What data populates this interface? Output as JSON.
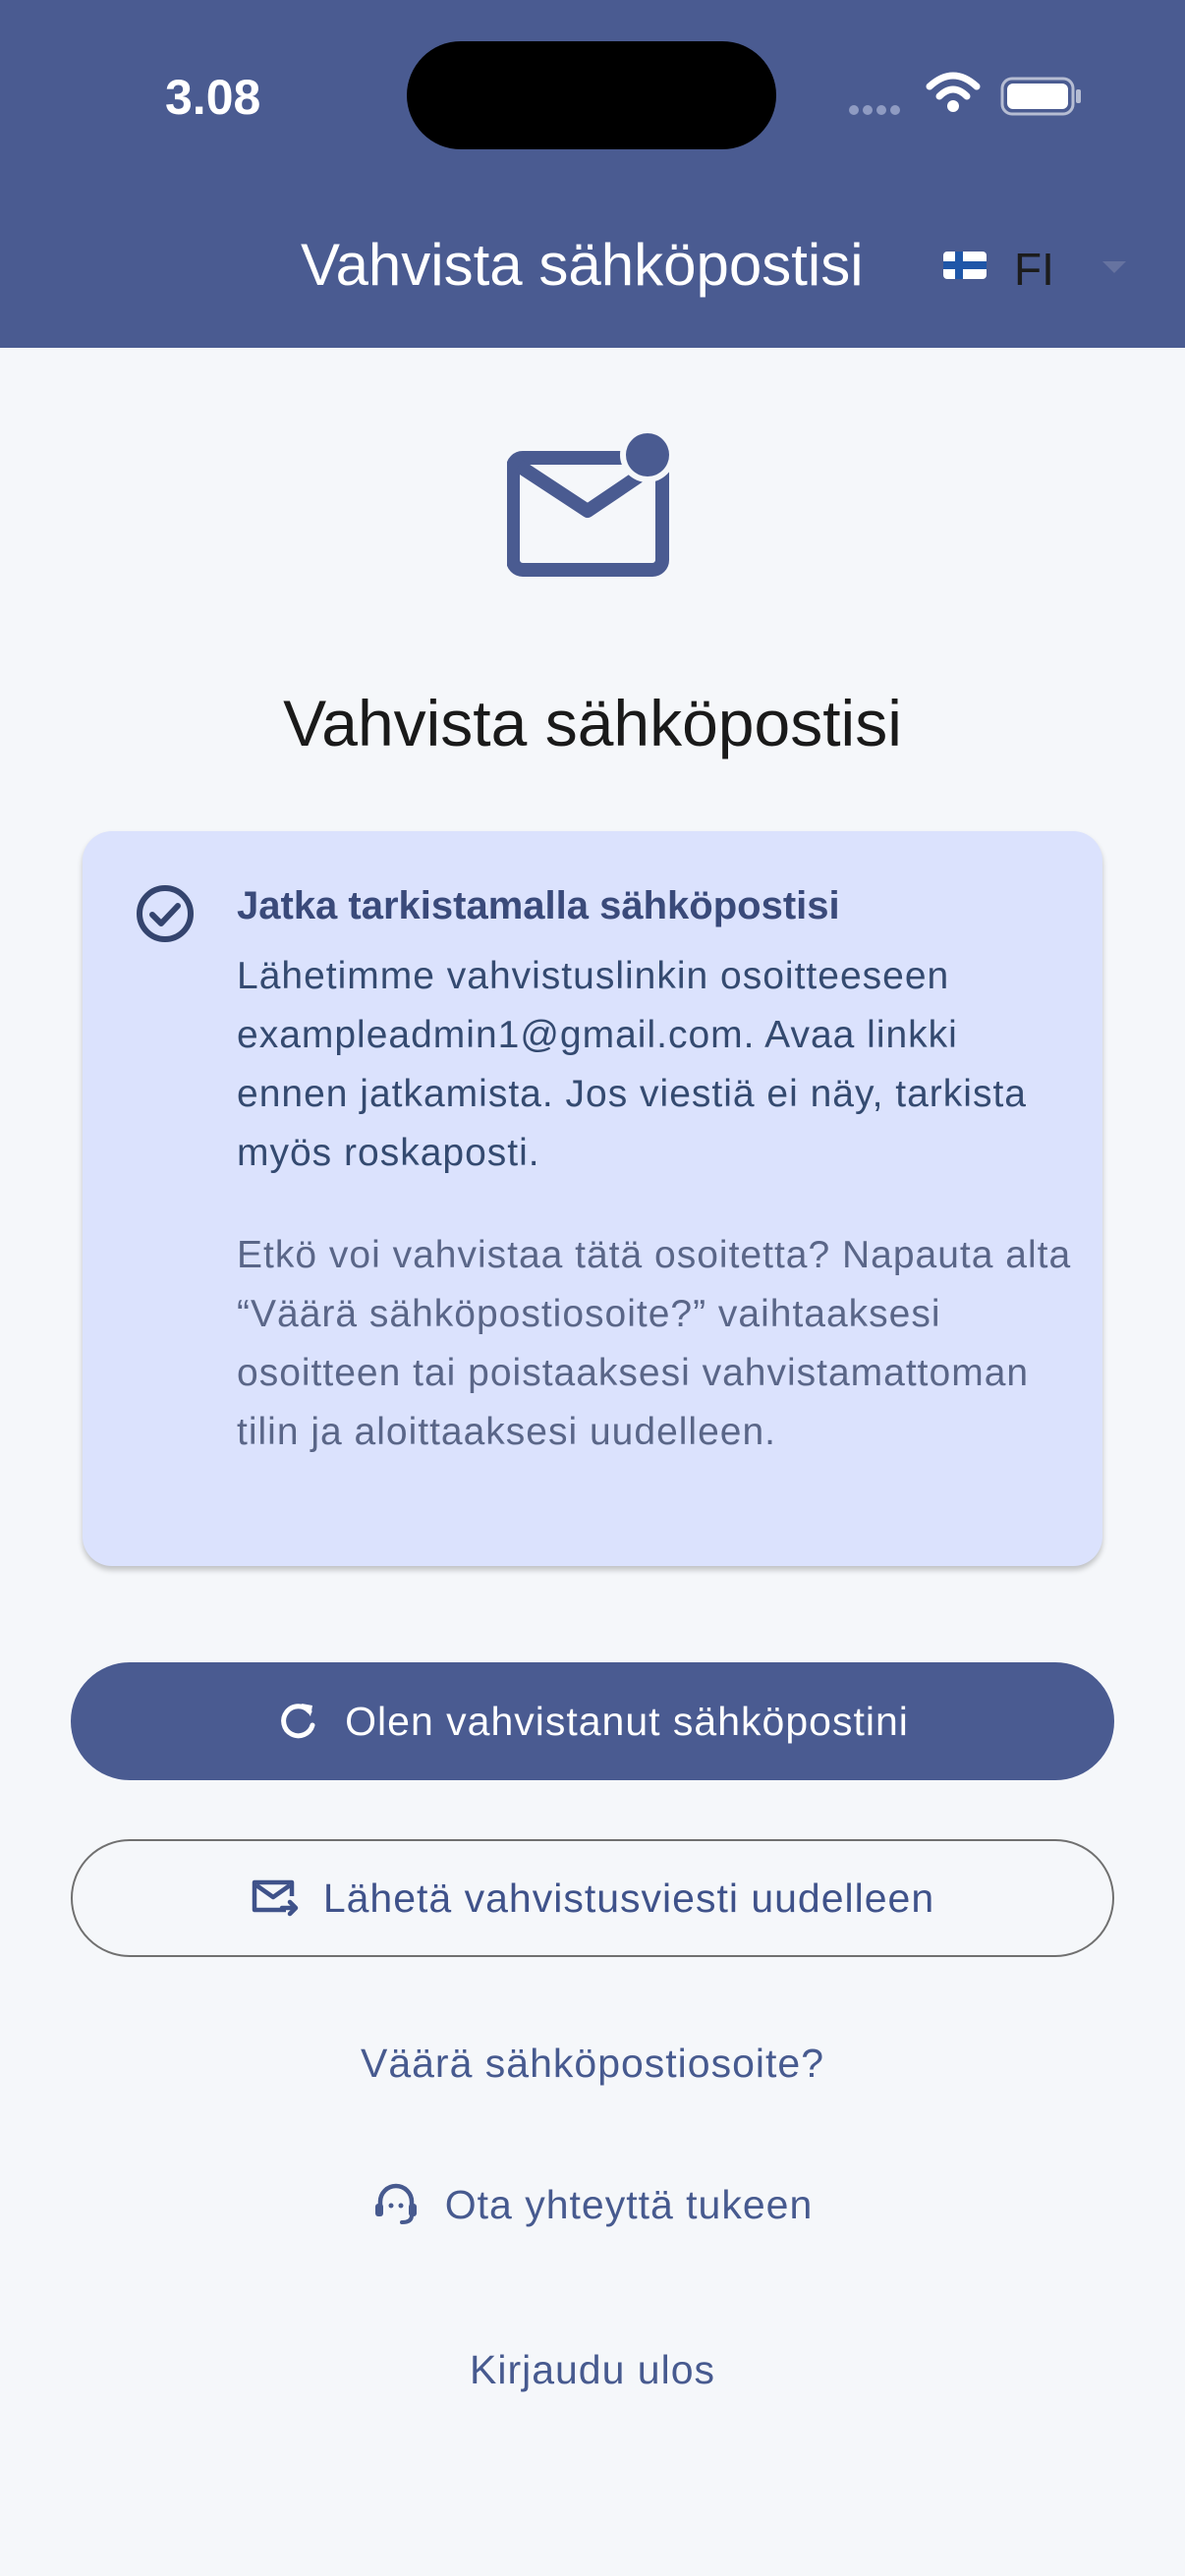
{
  "status_bar": {
    "time": "3.08"
  },
  "header": {
    "title": "Vahvista sähköpostisi",
    "language_code": "FI"
  },
  "main": {
    "title": "Vahvista sähköpostisi",
    "card": {
      "heading": "Jatka tarkistamalla sähköpostisi",
      "body": "Lähetimme vahvistuslinkin osoitteeseen exampleadmin1@gmail.com. Avaa linkki ennen jatkamista. Jos viestiä ei näy, tarkista myös roskaposti.",
      "secondary": "Etkö voi vahvistaa tätä osoitetta? Napauta alta “Väärä sähköpostiosoite?” vaihtaaksesi osoitteen tai poistaaksesi vahvistamattoman tilin ja aloittaaksesi uudelleen."
    },
    "primary_button": {
      "label": "Olen vahvistanut sähköpostini",
      "icon": "refresh-icon"
    },
    "secondary_button": {
      "label": "Lähetä vahvistusviesti uudelleen",
      "icon": "mail-send-icon"
    },
    "links": {
      "wrong_email": "Väärä sähköpostiosoite?",
      "support": "Ota yhteyttä tukeen",
      "logout": "Kirjaudu ulos"
    }
  },
  "colors": {
    "header_bg": "#4a5b91",
    "page_bg": "#f5f7fa",
    "card_bg": "#dbe2fd",
    "accent": "#4a5b91",
    "link": "#475a8f"
  }
}
